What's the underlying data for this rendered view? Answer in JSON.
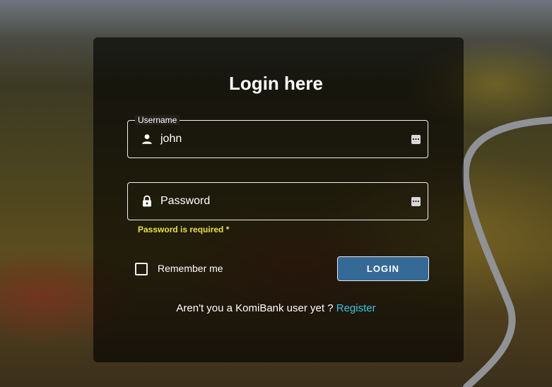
{
  "form": {
    "title": "Login here",
    "username": {
      "label": "Username",
      "value": "john",
      "icon": "person-icon"
    },
    "password": {
      "placeholder": "Password",
      "icon": "lock-icon",
      "error": "Password is required *"
    },
    "remember_label": "Remember me",
    "login_label": "LOGIN",
    "register_prompt": "Aren't you a KomiBank user yet ?",
    "register_link": "Register"
  },
  "colors": {
    "accent": "#366a96",
    "link": "#38c6e3",
    "error": "#e8e03a"
  }
}
